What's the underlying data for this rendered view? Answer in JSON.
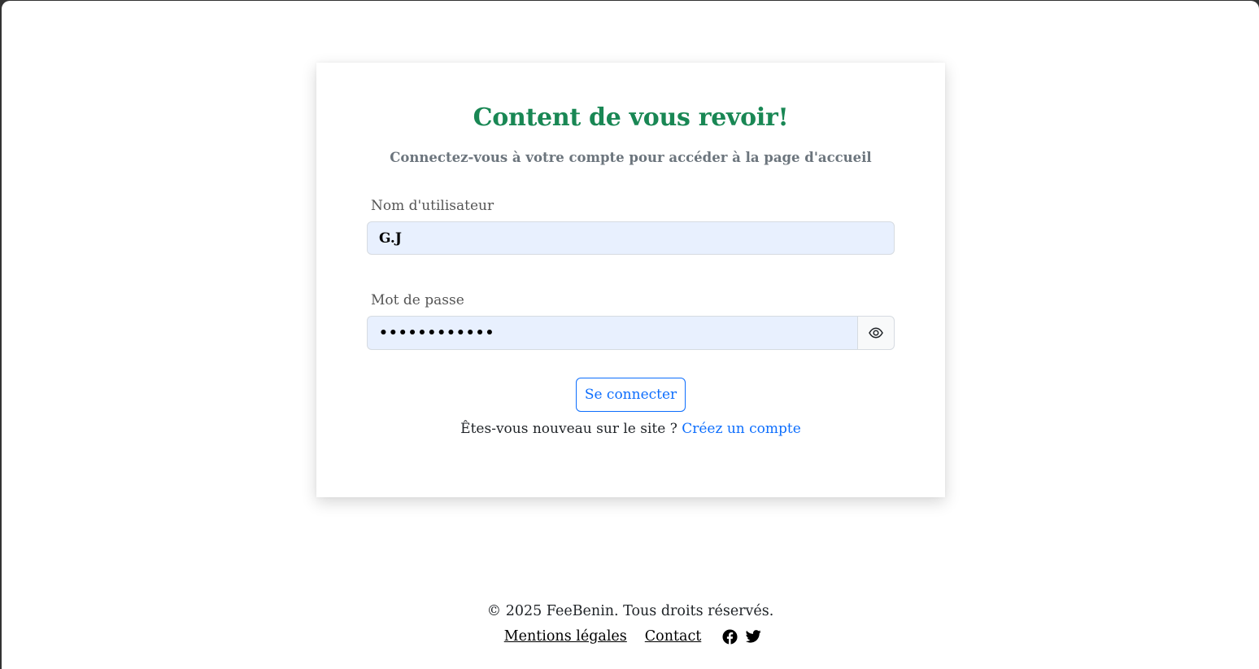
{
  "login": {
    "title": "Content de vous revoir!",
    "subtitle": "Connectez-vous à votre compte pour accéder à la page d'accueil",
    "username_label": "Nom d'utilisateur",
    "username_value": "G.J",
    "password_label": "Mot de passe",
    "password_value": "hiddenpass12",
    "submit_label": "Se connecter",
    "signup_prompt": "Êtes-vous nouveau sur le site ?",
    "signup_link": "Créez un compte"
  },
  "footer": {
    "copyright": "© 2025 FeeBenin. Tous droits réservés.",
    "links": [
      "Mentions légales",
      "Contact"
    ],
    "social_icons": [
      "facebook-icon",
      "twitter-icon"
    ]
  },
  "colors": {
    "title": "#198754",
    "link": "#0d6efd",
    "input_bg": "#e8f0fe"
  }
}
